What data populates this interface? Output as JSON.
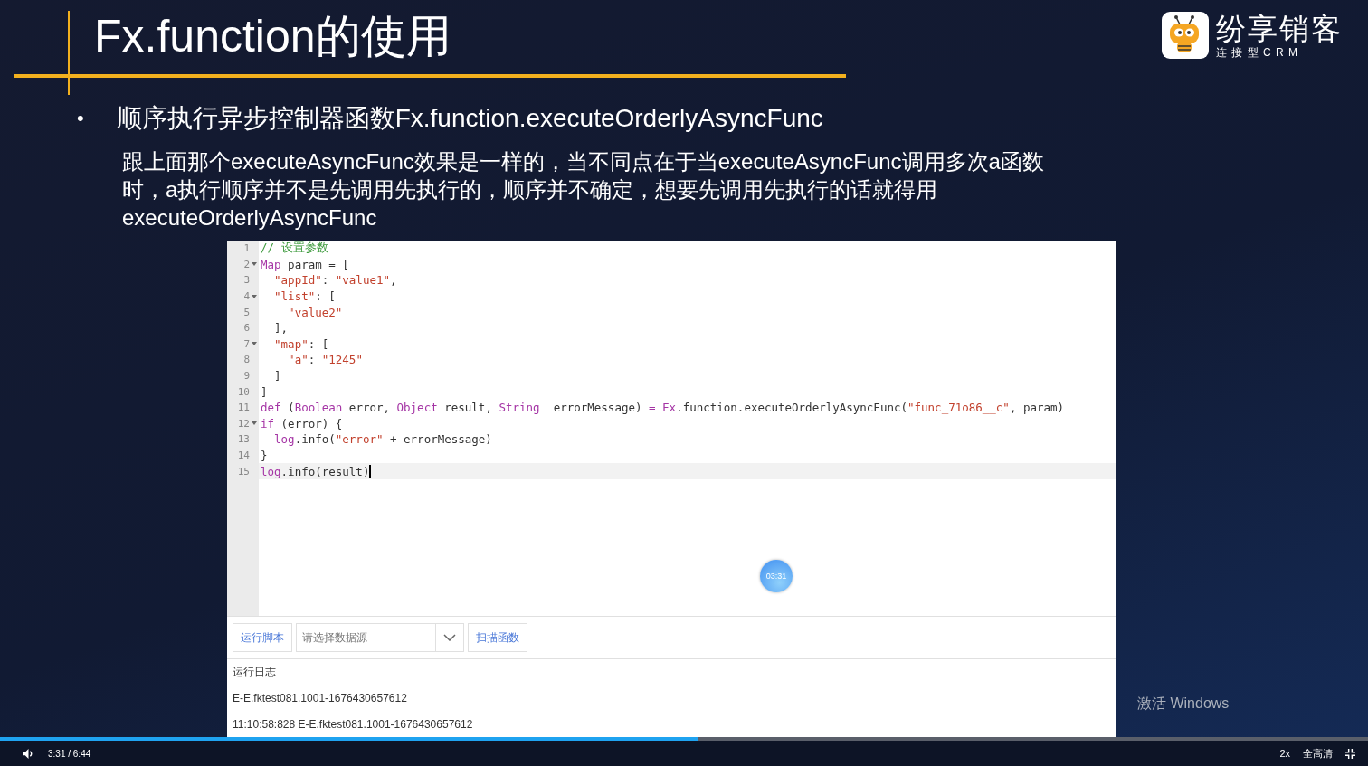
{
  "slide": {
    "title": "Fx.function的使用",
    "logo": {
      "name": "纷享销客",
      "tagline": "连 接 型 C R M"
    },
    "bullet": {
      "marker": "•",
      "text": "顺序执行异步控制器函数Fx.function.executeOrderlyAsyncFunc"
    },
    "paragraph": "跟上面那个executeAsyncFunc效果是一样的，当不同点在于当executeAsyncFunc调用多次a函数时，a执行顺序并不是先调用先执行的，顺序并不确定，想要先调用先执行的话就得用executeOrderlyAsyncFunc",
    "editor": {
      "lines": [
        {
          "n": "1",
          "fold": false,
          "active": false,
          "tokens": [
            {
              "kind": "comment",
              "text": "// 设置参数"
            }
          ]
        },
        {
          "n": "2",
          "fold": true,
          "active": false,
          "tokens": [
            {
              "kind": "keyword",
              "text": "Map"
            },
            {
              "kind": "plain",
              "text": " param = ["
            }
          ]
        },
        {
          "n": "3",
          "fold": false,
          "active": false,
          "tokens": [
            {
              "kind": "string",
              "text": "  \"appId\""
            },
            {
              "kind": "plain",
              "text": ": "
            },
            {
              "kind": "string",
              "text": "\"value1\""
            },
            {
              "kind": "plain",
              "text": ","
            }
          ]
        },
        {
          "n": "4",
          "fold": true,
          "active": false,
          "tokens": [
            {
              "kind": "string",
              "text": "  \"list\""
            },
            {
              "kind": "plain",
              "text": ": ["
            }
          ]
        },
        {
          "n": "5",
          "fold": false,
          "active": false,
          "tokens": [
            {
              "kind": "string",
              "text": "    \"value2\""
            }
          ]
        },
        {
          "n": "6",
          "fold": false,
          "active": false,
          "tokens": [
            {
              "kind": "plain",
              "text": "  ],"
            }
          ]
        },
        {
          "n": "7",
          "fold": true,
          "active": false,
          "tokens": [
            {
              "kind": "string",
              "text": "  \"map\""
            },
            {
              "kind": "plain",
              "text": ": ["
            }
          ]
        },
        {
          "n": "8",
          "fold": false,
          "active": false,
          "tokens": [
            {
              "kind": "string",
              "text": "    \"a\""
            },
            {
              "kind": "plain",
              "text": ": "
            },
            {
              "kind": "string",
              "text": "\"1245\""
            }
          ]
        },
        {
          "n": "9",
          "fold": false,
          "active": false,
          "tokens": [
            {
              "kind": "plain",
              "text": "  ]"
            }
          ]
        },
        {
          "n": "10",
          "fold": false,
          "active": false,
          "tokens": [
            {
              "kind": "plain",
              "text": "]"
            }
          ]
        },
        {
          "n": "11",
          "fold": false,
          "active": false,
          "tokens": [
            {
              "kind": "keyword",
              "text": "def"
            },
            {
              "kind": "plain",
              "text": " ("
            },
            {
              "kind": "keyword",
              "text": "Boolean"
            },
            {
              "kind": "plain",
              "text": " error, "
            },
            {
              "kind": "keyword",
              "text": "Object"
            },
            {
              "kind": "plain",
              "text": " result, "
            },
            {
              "kind": "keyword",
              "text": "String"
            },
            {
              "kind": "plain",
              "text": "  errorMessage) "
            },
            {
              "kind": "keyword",
              "text": "= Fx"
            },
            {
              "kind": "plain",
              "text": ".function.executeOrderlyAsyncFunc("
            },
            {
              "kind": "string",
              "text": "\"func_71o86__c\""
            },
            {
              "kind": "plain",
              "text": ", param)"
            }
          ]
        },
        {
          "n": "12",
          "fold": true,
          "active": false,
          "tokens": [
            {
              "kind": "keyword",
              "text": "if"
            },
            {
              "kind": "plain",
              "text": " (error) {"
            }
          ]
        },
        {
          "n": "13",
          "fold": false,
          "active": false,
          "tokens": [
            {
              "kind": "keyword",
              "text": "  log"
            },
            {
              "kind": "plain",
              "text": ".info("
            },
            {
              "kind": "string",
              "text": "\"error\""
            },
            {
              "kind": "plain",
              "text": " + errorMessage)"
            }
          ]
        },
        {
          "n": "14",
          "fold": false,
          "active": false,
          "tokens": [
            {
              "kind": "plain",
              "text": "}"
            }
          ]
        },
        {
          "n": "15",
          "fold": false,
          "active": true,
          "tokens": [
            {
              "kind": "keyword",
              "text": "log"
            },
            {
              "kind": "plain",
              "text": ".info(result)"
            }
          ]
        }
      ],
      "timer_badge": "03:31"
    },
    "toolbar": {
      "run_button": "运行脚本",
      "datasource": {
        "placeholder": "请选择数据源"
      },
      "scan_button": "扫描函数"
    },
    "log": {
      "title": "运行日志",
      "entries": [
        "E-E.fktest081.1001-1676430657612",
        "11:10:58:828 E-E.fktest081.1001-1676430657612"
      ]
    },
    "os_notice": "激活 Windows"
  },
  "player": {
    "progress": {
      "level": 0.51
    },
    "time": "3:31 / 6:44",
    "speed": "2x",
    "quality": "全高清"
  }
}
